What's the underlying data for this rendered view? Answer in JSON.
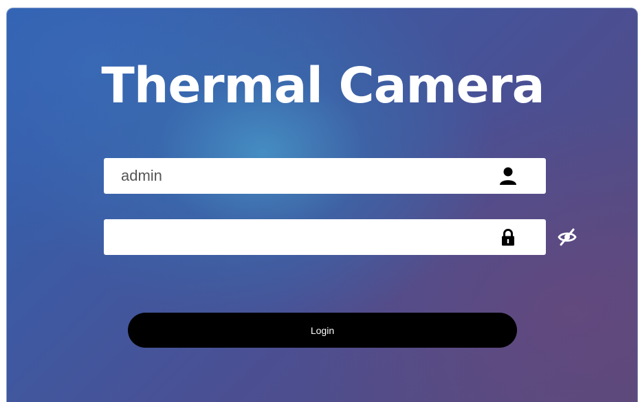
{
  "login_page": {
    "title": "Thermal Camera",
    "username": {
      "value": "admin",
      "icon": "user-icon"
    },
    "password": {
      "value": "",
      "icon": "lock-icon",
      "toggle_icon": "eye-slash-icon"
    },
    "login_button_label": "Login"
  }
}
